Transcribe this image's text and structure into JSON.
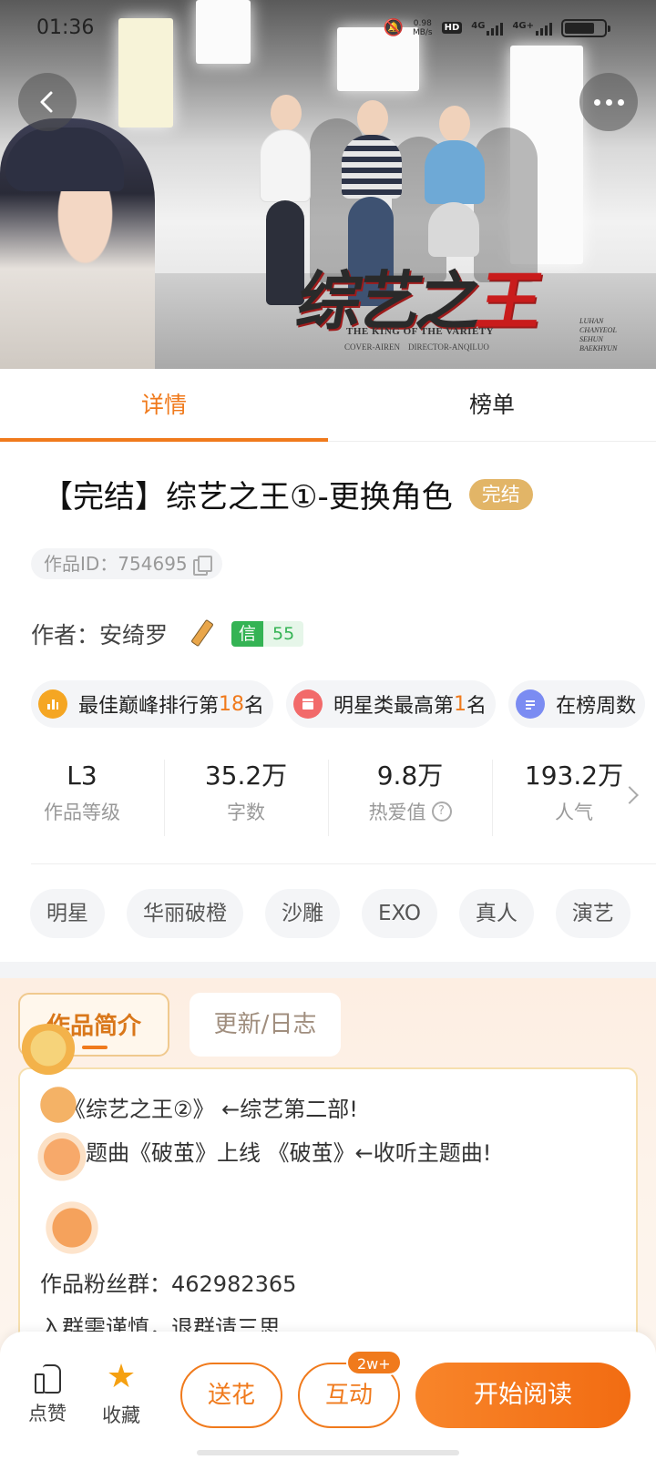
{
  "status_bar": {
    "time": "01:36",
    "net_speed_value": "0.98",
    "net_speed_unit": "MB/s",
    "hd_label": "HD",
    "signal1": "4G",
    "signal2": "4G+",
    "battery_level": 0.75
  },
  "cover": {
    "title_black": "综艺之",
    "title_red": "王",
    "subtitle": "THE KING OF THE VARIETY",
    "credit_cover": "COVER-AIREN",
    "credit_director": "DIRECTOR-ANQILUO",
    "names": [
      "LUHAN",
      "CHANYEOL",
      "SEHUN",
      "BAEKHYUN"
    ]
  },
  "tabs": [
    {
      "label": "详情",
      "active": true
    },
    {
      "label": "榜单",
      "active": false
    }
  ],
  "work": {
    "title": "【完结】综艺之王①-更换角色",
    "status_badge": "完结",
    "id_label": "作品ID：754695",
    "author_label": "作者：安绮罗",
    "credit_label": "信",
    "credit_value": "55"
  },
  "ranks": [
    {
      "prefix": "最佳巅峰排行第",
      "num": "18",
      "suffix": "名",
      "icon": "bar-chart-icon",
      "color": "#f5a623"
    },
    {
      "prefix": "明星类最高第",
      "num": "1",
      "suffix": "名",
      "icon": "clapper-icon",
      "color": "#f26a6a"
    },
    {
      "prefix": "在榜周数",
      "num": "",
      "suffix": "",
      "icon": "list-icon",
      "color": "#7b8cf2"
    }
  ],
  "stats": [
    {
      "value": "L3",
      "label": "作品等级"
    },
    {
      "value": "35.2万",
      "label": "字数"
    },
    {
      "value": "9.8万",
      "label": "热爱值"
    },
    {
      "value": "193.2万",
      "label": "人气"
    }
  ],
  "tags": [
    "明星",
    "华丽破橙",
    "沙雕",
    "EXO",
    "真人",
    "演艺"
  ],
  "intro": {
    "tabs": [
      "作品简介",
      "更新/日志"
    ],
    "lines": [
      "《综艺之王②》 ←综艺第二部!",
      "主题曲《破茧》上线 《破茧》←收听主题曲!",
      "作品粉丝群：462982365",
      "入群需谨慎，退群请三思"
    ]
  },
  "bottom_bar": {
    "like_label": "点赞",
    "favorite_label": "收藏",
    "flower_label": "送花",
    "interact_label": "互动",
    "interact_badge": "2w+",
    "read_label": "开始阅读"
  },
  "colors": {
    "accent": "#f07a1c",
    "badge_gold": "#e2b567",
    "credit_green": "#34b354"
  }
}
